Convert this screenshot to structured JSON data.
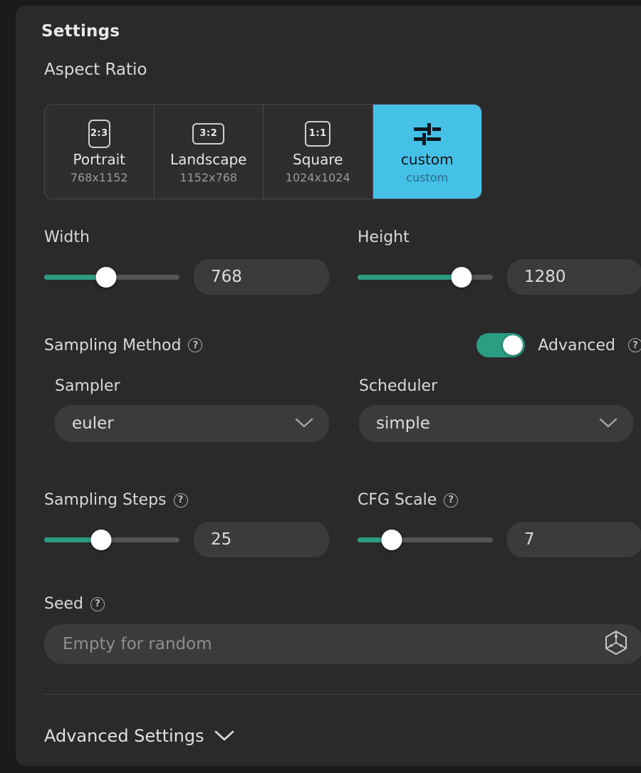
{
  "panel": {
    "title": "Settings"
  },
  "aspect_ratio": {
    "label": "Aspect Ratio",
    "options": [
      {
        "name": "Portrait",
        "dim": "768x1152",
        "ratio": "2:3",
        "icon": "portrait-ratio-icon",
        "selected": false
      },
      {
        "name": "Landscape",
        "dim": "1152x768",
        "ratio": "3:2",
        "icon": "landscape-ratio-icon",
        "selected": false
      },
      {
        "name": "Square",
        "dim": "1024x1024",
        "ratio": "1:1",
        "icon": "square-ratio-icon",
        "selected": false
      },
      {
        "name": "custom",
        "dim": "custom",
        "ratio": "",
        "icon": "sliders-icon",
        "selected": true
      }
    ],
    "selected_color": "#45c1e8"
  },
  "width": {
    "label": "Width",
    "value": "768",
    "slider_percent": 46
  },
  "height": {
    "label": "Height",
    "value": "1280",
    "slider_percent": 77
  },
  "sampling_method": {
    "label": "Sampling Method",
    "help": "?",
    "advanced_label": "Advanced",
    "advanced_on": true,
    "toggle_color": "#2a9d82"
  },
  "sampler": {
    "label": "Sampler",
    "value": "euler",
    "chevron": "chevron-down-icon"
  },
  "scheduler": {
    "label": "Scheduler",
    "value": "simple",
    "chevron": "chevron-down-icon"
  },
  "sampling_steps": {
    "label": "Sampling Steps",
    "help": "?",
    "value": "25",
    "slider_percent": 42
  },
  "cfg_scale": {
    "label": "CFG Scale",
    "help": "?",
    "value": "7",
    "slider_percent": 25
  },
  "seed": {
    "label": "Seed",
    "help": "?",
    "value": "",
    "placeholder": "Empty for random",
    "dice_icon": "dice-icon"
  },
  "advanced_settings": {
    "label": "Advanced Settings",
    "chevron": "chevron-down-icon"
  },
  "colors": {
    "accent_slider": "#2a9d82",
    "accent_selected": "#45c1e8",
    "panel_bg": "#2a2a2a",
    "page_bg": "#1b1b1b"
  }
}
